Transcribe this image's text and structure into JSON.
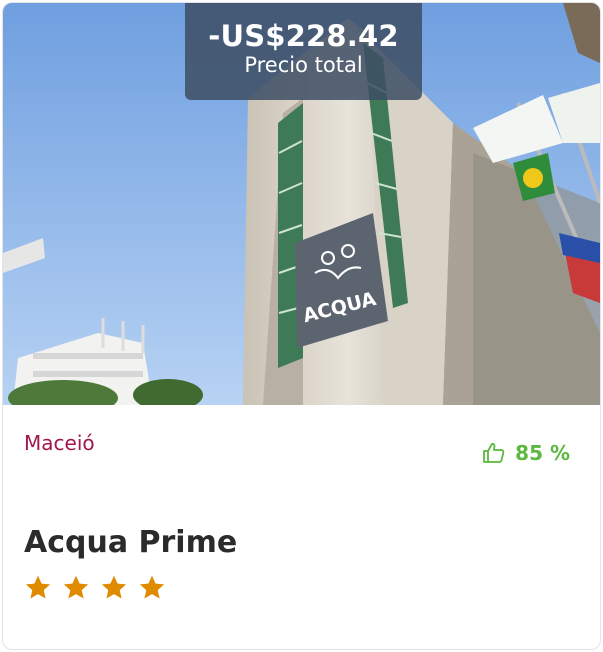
{
  "price": {
    "amount": "-US$228.42",
    "label": "Precio total"
  },
  "hotel": {
    "city": "Maceió",
    "rating": "85 %",
    "name": "Acqua Prime",
    "stars": 4,
    "sign_text": "ACQUA"
  },
  "colors": {
    "city": "#a0174d",
    "rating": "#5cb83f",
    "star": "#e08a00",
    "badge_bg": "#3e4e64"
  },
  "icons": {
    "rating": "thumbs-up-icon",
    "star": "star-icon"
  }
}
